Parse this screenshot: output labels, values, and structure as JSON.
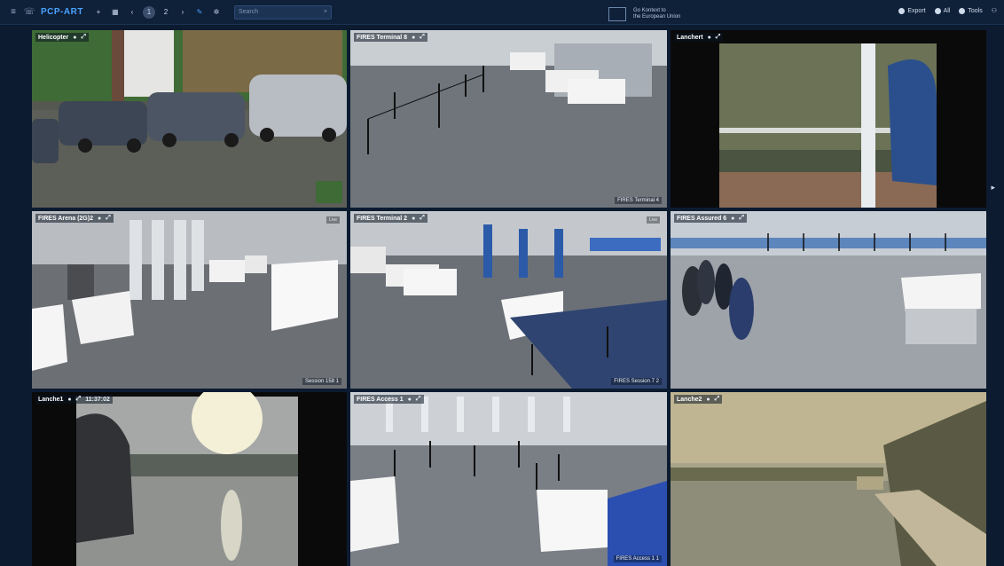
{
  "app": {
    "title": "PCP-ART"
  },
  "toolbar": {
    "buttons": [
      "+",
      "▦",
      "‹",
      "1",
      "2",
      "›"
    ],
    "search_placeholder": "Search"
  },
  "center_info": {
    "line1": "Go Kontext to",
    "line2": "the European Union"
  },
  "right_tools": [
    "Export",
    "All",
    "Tools"
  ],
  "cameras": [
    {
      "label": "Helicopter",
      "footer": "",
      "tag": ""
    },
    {
      "label": "FIRES Terminal 8",
      "footer": "FIRES Terminal 4",
      "tag": ""
    },
    {
      "label": "Lanchert",
      "footer": "",
      "tag": ""
    },
    {
      "label": "FIRES Arena (2G)2",
      "footer": "Session 158 1",
      "tag": "Live"
    },
    {
      "label": "FIRES Terminal 2",
      "footer": "FIRES Session 7 2",
      "tag": "Live"
    },
    {
      "label": "FIRES Assured 6",
      "footer": "",
      "tag": ""
    },
    {
      "label": "Lanche1",
      "footer": "",
      "tag": "11:37:02"
    },
    {
      "label": "FIRES Access 1",
      "footer": "FIRES Access 1 1",
      "tag": ""
    },
    {
      "label": "Lanche2",
      "footer": "",
      "tag": ""
    }
  ],
  "colors": {
    "background": "#0c1b30",
    "accent": "#4aa3ff",
    "topbar": "#0f2039"
  }
}
